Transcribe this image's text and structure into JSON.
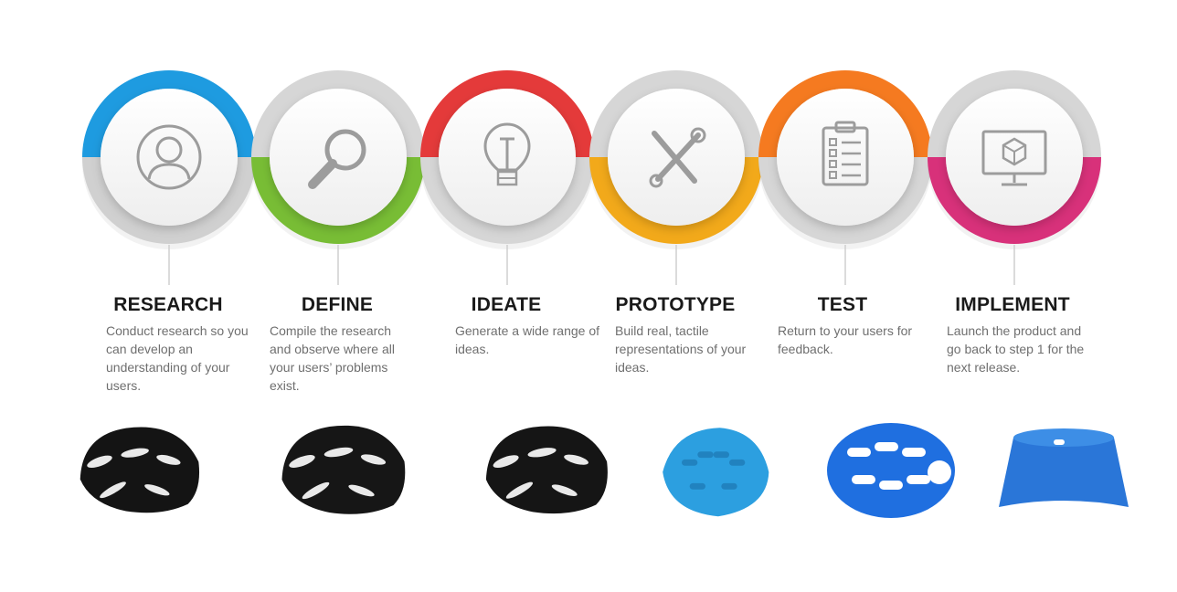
{
  "steps": [
    {
      "title": "RESEARCH",
      "description": "Conduct research so you can develop an understanding of your users.",
      "icon": "user-avatar-icon",
      "color_top": "#1e9be0",
      "color_bottom": "#d0d0d0"
    },
    {
      "title": "DEFINE",
      "description": "Compile the research and observe where all your users’ problems exist.",
      "icon": "magnifier-icon",
      "color_top": "#d6d6d6",
      "color_bottom": "#78bd35"
    },
    {
      "title": "IDEATE",
      "description": "Generate a wide range of ideas.",
      "icon": "lightbulb-icon",
      "color_top": "#e43a3a",
      "color_bottom": "#d6d6d6"
    },
    {
      "title": "PROTOTYPE",
      "description": "Build real, tactile representations of your ideas.",
      "icon": "tools-icon",
      "color_top": "#d6d6d6",
      "color_bottom": "#f2a91a"
    },
    {
      "title": "TEST",
      "description": "Return to your users for feedback.",
      "icon": "clipboard-checklist-icon",
      "color_top": "#f57a20",
      "color_bottom": "#d6d6d6"
    },
    {
      "title": "IMPLEMENT",
      "description": "Launch the product and go back to step 1 for the next release.",
      "icon": "monitor-cube-icon",
      "color_top": "#d6d6d6",
      "color_bottom": "#d8317a"
    }
  ],
  "helmets": [
    {
      "name": "black helmet 1",
      "color": "#141414"
    },
    {
      "name": "black helmet 2",
      "color": "#161616"
    },
    {
      "name": "black helmet 3",
      "color": "#151515"
    },
    {
      "name": "light blue helmet",
      "color": "#2c9fe0"
    },
    {
      "name": "blue helmet",
      "color": "#1f6fe0"
    },
    {
      "name": "blue helmet shell",
      "color": "#2a76d8"
    }
  ]
}
